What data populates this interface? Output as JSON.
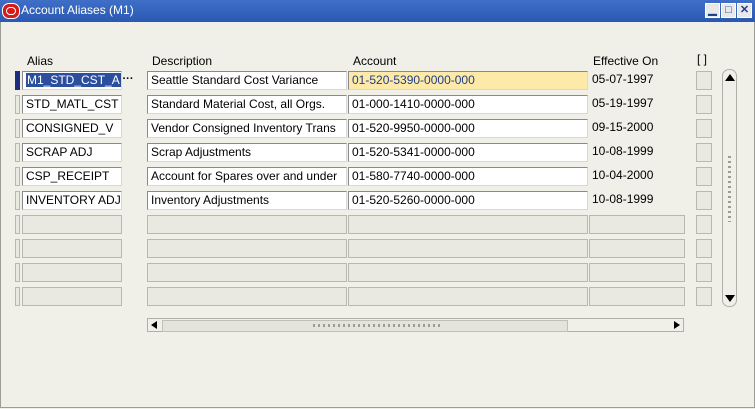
{
  "window": {
    "title": "Account Aliases (M1)",
    "minimize_glyph": "▁",
    "maximize_glyph": "□",
    "close_glyph": "✕"
  },
  "table": {
    "columns": {
      "alias": "Alias",
      "description": "Description",
      "account": "Account",
      "effective_on": "Effective On",
      "flex": "[ ]"
    },
    "rows": [
      {
        "alias": "M1_STD_CST_A",
        "description": "Seattle Standard Cost Variance",
        "account": "01-520-5390-0000-000",
        "effective_on": "05-07-1997"
      },
      {
        "alias": "STD_MATL_CST",
        "description": "Standard Material Cost, all Orgs.",
        "account": "01-000-1410-0000-000",
        "effective_on": "05-19-1997"
      },
      {
        "alias": "CONSIGNED_V",
        "description": "Vendor Consigned Inventory Trans",
        "account": "01-520-9950-0000-000",
        "effective_on": "09-15-2000"
      },
      {
        "alias": "SCRAP ADJ",
        "description": "Scrap Adjustments",
        "account": "01-520-5341-0000-000",
        "effective_on": "10-08-1999"
      },
      {
        "alias": "CSP_RECEIPT",
        "description": "Account for Spares over and under",
        "account": "01-580-7740-0000-000",
        "effective_on": "10-04-2000"
      },
      {
        "alias": "INVENTORY ADJ",
        "description": "Inventory Adjustments",
        "account": "01-520-5260-0000-000",
        "effective_on": "10-08-1999"
      }
    ],
    "empty_row_count": 4,
    "lov_glyph": "···"
  },
  "colors": {
    "titlebar": "#2a59b3",
    "selected_text_bg": "#2b4f9e",
    "highlight_field": "#fde9a8",
    "record_indicator": "#1b2f7e"
  }
}
